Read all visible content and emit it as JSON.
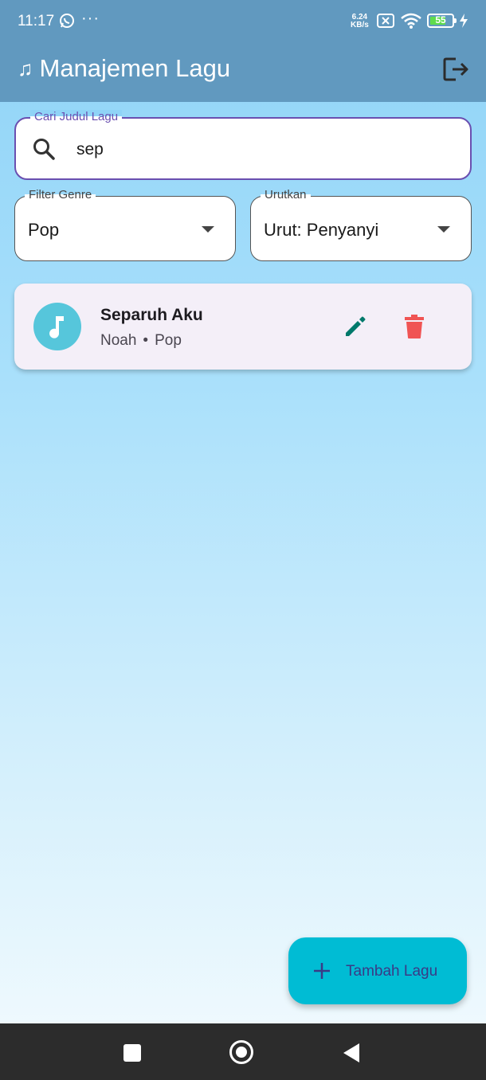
{
  "status_bar": {
    "time": "11:17",
    "more": "···",
    "net_speed_value": "6.24",
    "net_speed_unit": "KB/s",
    "battery_level": "55"
  },
  "app_bar": {
    "icon": "♫",
    "title": "Manajemen Lagu"
  },
  "search": {
    "label": "Cari Judul Lagu",
    "value": "sep"
  },
  "filters": {
    "genre": {
      "label": "Filter Genre",
      "value": "Pop"
    },
    "sort": {
      "label": "Urutkan",
      "value": "Urut: Penyanyi"
    }
  },
  "songs": [
    {
      "title": "Separuh Aku",
      "artist": "Noah",
      "separator": "•",
      "genre": "Pop"
    }
  ],
  "fab": {
    "label": "Tambah Lagu"
  },
  "colors": {
    "app_bar": "#6199bf",
    "accent_outline": "#6a4fb0",
    "avatar": "#56c6db",
    "edit_icon": "#00796b",
    "delete_icon": "#f05454",
    "fab": "#00bcd4"
  },
  "icons": {
    "logout": "logout-icon",
    "search": "search-icon",
    "music": "music-note-icon",
    "edit": "pencil-icon",
    "delete": "trash-icon",
    "add": "plus-icon"
  }
}
